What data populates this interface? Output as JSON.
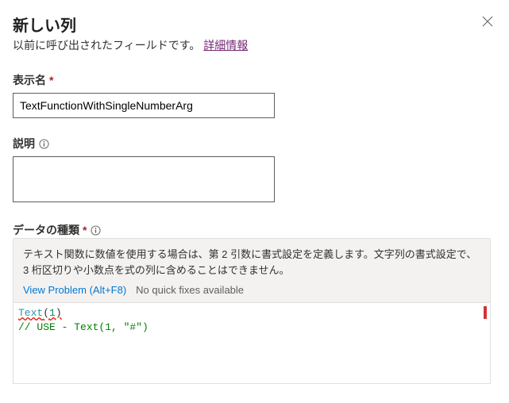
{
  "header": {
    "title": "新しい列",
    "subtitle_prefix": "以前に呼び出されたフィールドです。 ",
    "link_label": "詳細情報"
  },
  "fields": {
    "displayName": {
      "label": "表示名",
      "value": "TextFunctionWithSingleNumberArg"
    },
    "description": {
      "label": "説明",
      "value": ""
    },
    "dataType": {
      "label": "データの種類"
    }
  },
  "tooltip": {
    "message": "テキスト関数に数値を使用する場合は、第 2 引数に書式設定を定義します。文字列の書式設定で、3 桁区切りや小数点を式の列に含めることはできません。",
    "view_problem": "View Problem (Alt+F8)",
    "no_fixes": "No quick fixes available"
  },
  "code": {
    "fn": "Text",
    "open": "(",
    "arg": "1",
    "close": ")",
    "comment": "// USE - Text(1, \"#\")"
  }
}
